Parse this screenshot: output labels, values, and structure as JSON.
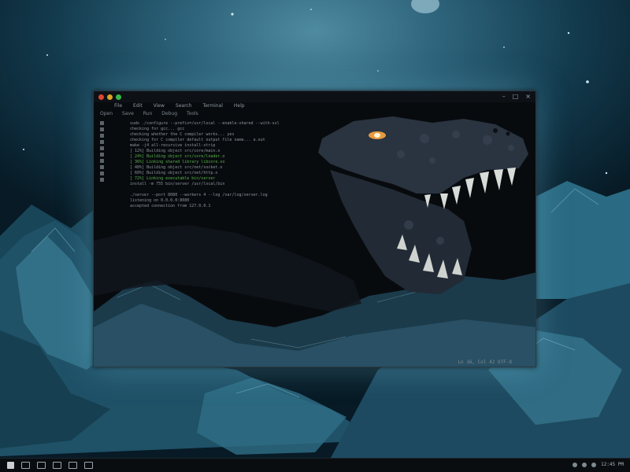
{
  "window": {
    "title": "",
    "controls": {
      "minimize": "–",
      "maximize": "□",
      "close": "×"
    },
    "menu": [
      "File",
      "Edit",
      "View",
      "Search",
      "Terminal",
      "Help"
    ],
    "toolbar": [
      "Open",
      "Save",
      "Run",
      "Debug",
      "Tools"
    ],
    "code_lines": [
      {
        "text": "sudo ./configure --prefix=/usr/local --enable-shared --with-ssl",
        "style": "norm"
      },
      {
        "text": "  checking for gcc... gcc",
        "style": "norm"
      },
      {
        "text": "  checking whether the C compiler works... yes",
        "style": "norm"
      },
      {
        "text": "  checking for C compiler default output file name... a.out",
        "style": "norm"
      },
      {
        "text": "    make -j4 all-recursive install-strip",
        "style": "norm"
      },
      {
        "text": "    [ 12%] Building object src/core/main.o",
        "style": "norm"
      },
      {
        "text": "    [ 24%] Building object src/core/loader.o",
        "style": "green"
      },
      {
        "text": "    [ 36%] Linking shared library libcore.so",
        "style": "green"
      },
      {
        "text": "    [ 48%] Building object src/net/socket.o",
        "style": "norm"
      },
      {
        "text": "    [ 60%] Building object src/net/http.o",
        "style": "norm"
      },
      {
        "text": "    [ 72%] Linking executable bin/server",
        "style": "green"
      },
      {
        "text": "  install -m 755 bin/server /usr/local/bin",
        "style": "norm"
      },
      {
        "text": "",
        "style": "norm"
      },
      {
        "text": "  ./server --port 8080 --workers 4 --log /var/log/server.log",
        "style": "norm"
      },
      {
        "text": "  listening on 0.0.0.0:8080",
        "style": "norm"
      },
      {
        "text": "  accepted connection from 127.0.0.1",
        "style": "norm"
      }
    ],
    "status": "Ln 16, Col 42   UTF-8"
  },
  "taskbar": {
    "clock": "12:45 PM"
  },
  "colors": {
    "accent_glow": "#78c8e6",
    "terminal_green": "#57b04a",
    "dino_eye": "#f0a040"
  },
  "icons": [
    "close-dot",
    "minimize-dot",
    "maximize-dot",
    "start-icon",
    "folder-icon",
    "browser-icon",
    "terminal-icon",
    "files-icon",
    "settings-icon"
  ]
}
